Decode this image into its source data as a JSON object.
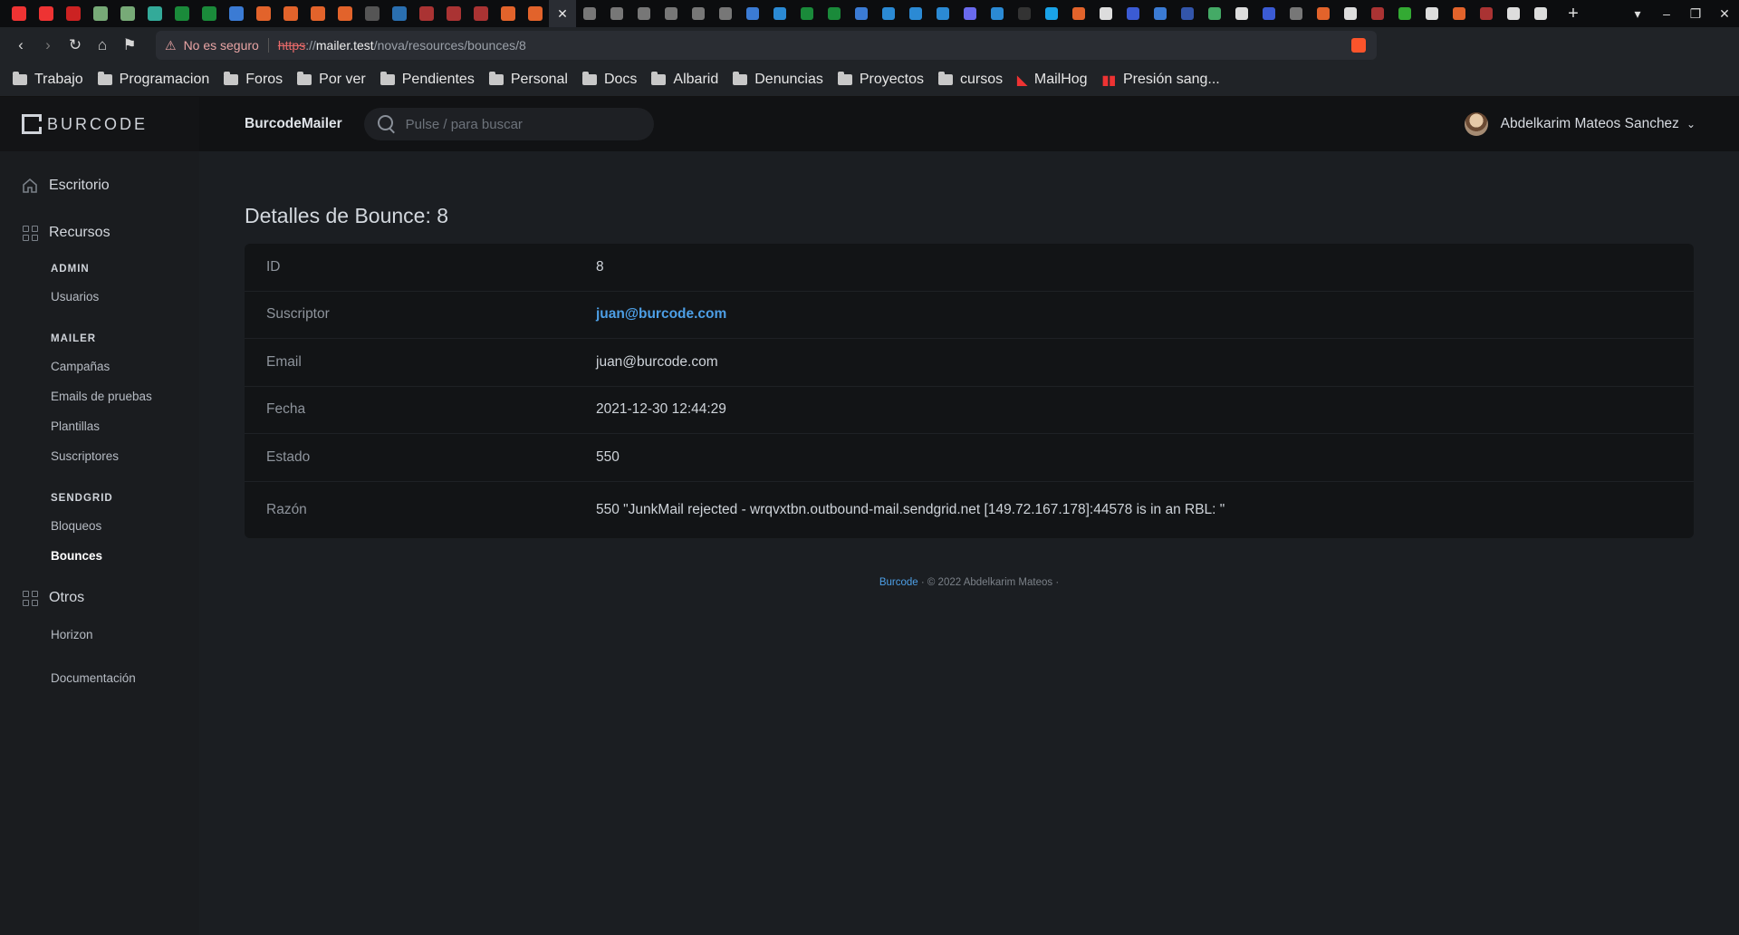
{
  "browser": {
    "url_warning": "No es seguro",
    "url_scheme": "https",
    "url_host": "mailer.test",
    "url_path": "/nova/resources/bounces/8",
    "bookmarks": [
      {
        "label": "Trabajo",
        "icon": "folder-icon"
      },
      {
        "label": "Programacion",
        "icon": "folder-icon"
      },
      {
        "label": "Foros",
        "icon": "folder-icon"
      },
      {
        "label": "Por ver",
        "icon": "folder-icon"
      },
      {
        "label": "Pendientes",
        "icon": "folder-icon"
      },
      {
        "label": "Personal",
        "icon": "folder-icon"
      },
      {
        "label": "Docs",
        "icon": "folder-icon"
      },
      {
        "label": "Albarid",
        "icon": "folder-icon"
      },
      {
        "label": "Denuncias",
        "icon": "folder-icon"
      },
      {
        "label": "Proyectos",
        "icon": "folder-icon"
      },
      {
        "label": "cursos",
        "icon": "folder-icon"
      },
      {
        "label": "MailHog",
        "icon": "mailhog-icon"
      },
      {
        "label": "Presión sang...",
        "icon": "pressure-icon"
      }
    ]
  },
  "app": {
    "logo_text": "BURCODE",
    "brand": "BurcodeMailer",
    "search_placeholder": "Pulse / para buscar",
    "user_name": "Abdelkarim Mateos Sanchez"
  },
  "sidebar": {
    "dashboard": "Escritorio",
    "resources": "Recursos",
    "groups": [
      {
        "heading": "ADMIN",
        "items": [
          "Usuarios"
        ]
      },
      {
        "heading": "MAILER",
        "items": [
          "Campañas",
          "Emails de pruebas",
          "Plantillas",
          "Suscriptores"
        ]
      },
      {
        "heading": "SENDGRID",
        "items": [
          "Bloqueos",
          "Bounces"
        ]
      }
    ],
    "others": "Otros",
    "others_items": [
      "Horizon",
      "Documentación"
    ]
  },
  "detail": {
    "title": "Detalles de Bounce: 8",
    "rows": [
      {
        "label": "ID",
        "value": "8"
      },
      {
        "label": "Suscriptor",
        "value": "juan@burcode.com"
      },
      {
        "label": "Email",
        "value": "juan@burcode.com"
      },
      {
        "label": "Fecha",
        "value": "2021-12-30 12:44:29"
      },
      {
        "label": "Estado",
        "value": "550"
      },
      {
        "label": "Razón",
        "value": "550 \"JunkMail rejected - wrqvxtbn.outbound-mail.sendgrid.net [149.72.167.178]:44578 is in an RBL: \""
      }
    ]
  },
  "footer": {
    "link": "Burcode",
    "text": "© 2022 Abdelkarim Mateos"
  }
}
